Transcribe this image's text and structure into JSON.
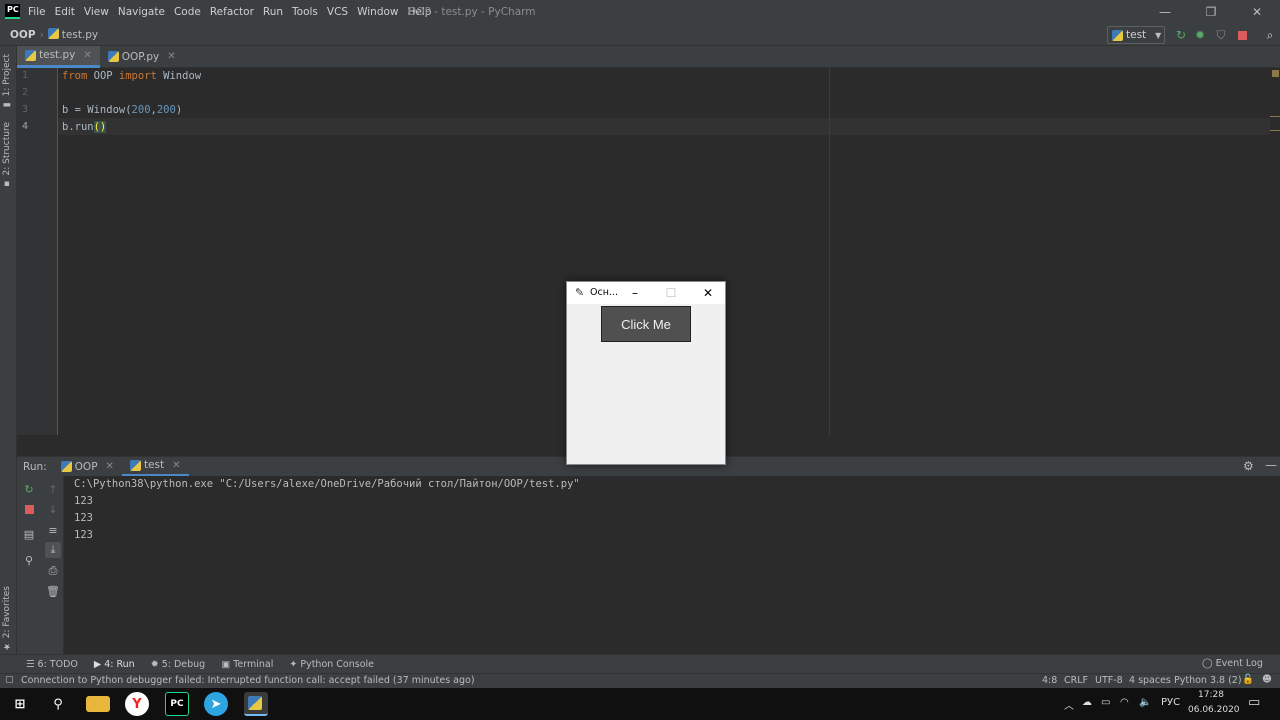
{
  "app": {
    "logo_text": "PC",
    "menu": [
      "File",
      "Edit",
      "View",
      "Navigate",
      "Code",
      "Refactor",
      "Run",
      "Tools",
      "VCS",
      "Window",
      "Help"
    ],
    "window_title": "OOP - test.py - PyCharm"
  },
  "navbar": {
    "project": "OOP",
    "file": "test.py",
    "run_config": "test"
  },
  "left_stripe": {
    "project_tab": "1: Project",
    "structure_tab": "2: Structure",
    "favorites_tab": "2: Favorites"
  },
  "editor": {
    "tabs": [
      {
        "label": "test.py",
        "active": true
      },
      {
        "label": "OOP.py",
        "active": false
      }
    ],
    "line_numbers": [
      "1",
      "2",
      "3",
      "4"
    ],
    "lines": {
      "l1_kw1": "from",
      "l1_mod": " OOP ",
      "l1_kw2": "import",
      "l1_name": " Window",
      "l3_pre": "b = Window(",
      "l3_n1": "200",
      "l3_comma": ",",
      "l3_n2": "200",
      "l3_post": ")",
      "l4_pre": "b.run",
      "l4_paren": "()"
    }
  },
  "run_panel": {
    "label": "Run:",
    "tabs": [
      {
        "label": "OOP",
        "active": false
      },
      {
        "label": "test",
        "active": true
      }
    ],
    "console": [
      "C:\\Python38\\python.exe \"C:/Users/alexe/OneDrive/Рабочий стол/Пайтон/OOP/test.py\"",
      "123",
      "123",
      "123"
    ]
  },
  "bottom_tabs": [
    {
      "label": "6: TODO",
      "icon": "list-icon"
    },
    {
      "label": "4: Run",
      "icon": "play-icon"
    },
    {
      "label": "5: Debug",
      "icon": "bug-icon"
    },
    {
      "label": "Terminal",
      "icon": "terminal-icon"
    },
    {
      "label": "Python Console",
      "icon": "python-icon"
    }
  ],
  "event_log": "Event Log",
  "status": {
    "message": "Connection to Python debugger failed: Interrupted function call: accept failed (37 minutes ago)",
    "position": "4:8",
    "line_sep": "CRLF",
    "encoding": "UTF-8",
    "indent": "4 spaces",
    "interpreter": "Python 3.8 (2)"
  },
  "tk_window": {
    "title": "Осн...",
    "button_label": "Click Me"
  },
  "taskbar": {
    "yandex_letter": "Y",
    "pc_letter": "PC",
    "lang": "РУС",
    "time": "17:28",
    "date": "06.06.2020"
  },
  "colors": {
    "accent": "#4a88c7",
    "run_green": "#59a869",
    "stop_red": "#db5c5c",
    "keyword": "#cc7832",
    "number": "#6897bb"
  }
}
